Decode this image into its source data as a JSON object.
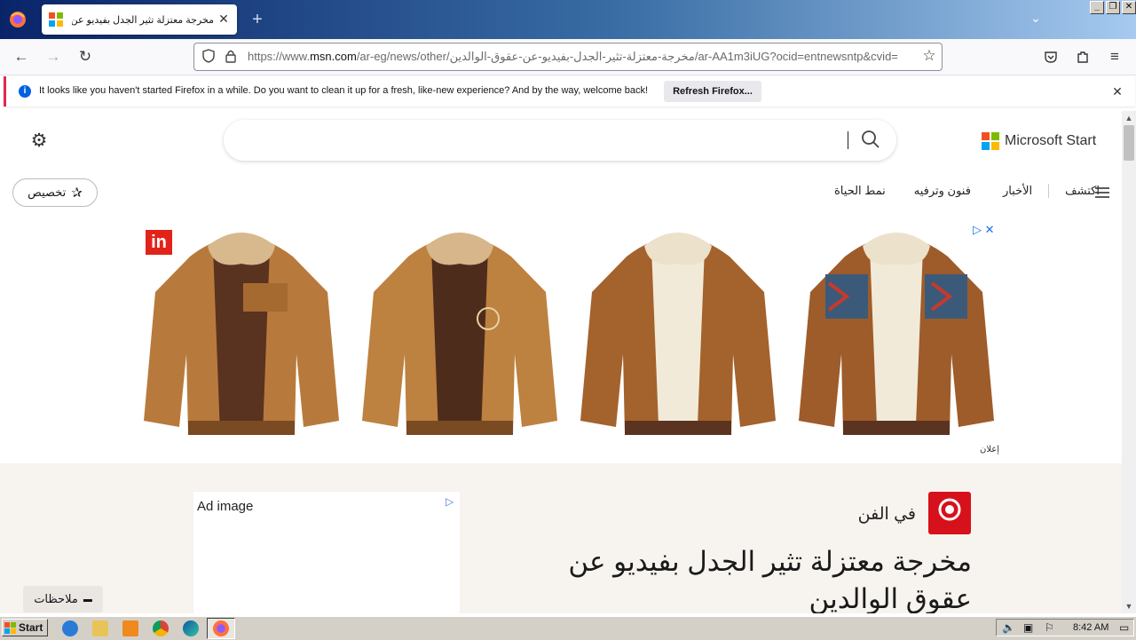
{
  "browser": {
    "tab_title": "مخرجة معتزلة تثير الجدل بفيديو عن",
    "url_prefix": "https://www.",
    "url_host": "msn.com",
    "url_rest": "/ar-eg/news/other/مخرجة-معتزلة-تثير-الجدل-بفيديو-عن-عقوق-الوالدين/ar-AA1m3iUG?ocid=entnewsntp&cvid=",
    "notification_text": "It looks like you haven't started Firefox in a while. Do you want to clean it up for a fresh, like-new experience? And by the way, welcome back!",
    "notification_button": "Refresh Firefox..."
  },
  "msn": {
    "logo_text": "Microsoft Start",
    "customize_label": "تخصيص",
    "nav_links": [
      "اكتشف",
      "الأخبار",
      "فنون وترفيه",
      "نمط الحياة"
    ]
  },
  "ad": {
    "label": "إعلان",
    "badge": "in"
  },
  "article": {
    "ad_image_label": "Ad image",
    "publisher": "في الفن",
    "headline": "مخرجة معتزلة تثير الجدل بفيديو عن عقوق الوالدين",
    "feedback_label": "ملاحظات"
  },
  "taskbar": {
    "start_label": "Start",
    "clock": "8:42 AM"
  },
  "colors": {
    "ms_red": "#f25022",
    "ms_green": "#7fba00",
    "ms_blue": "#00a4ef",
    "ms_yellow": "#ffb900",
    "publisher_red": "#d6111c"
  }
}
